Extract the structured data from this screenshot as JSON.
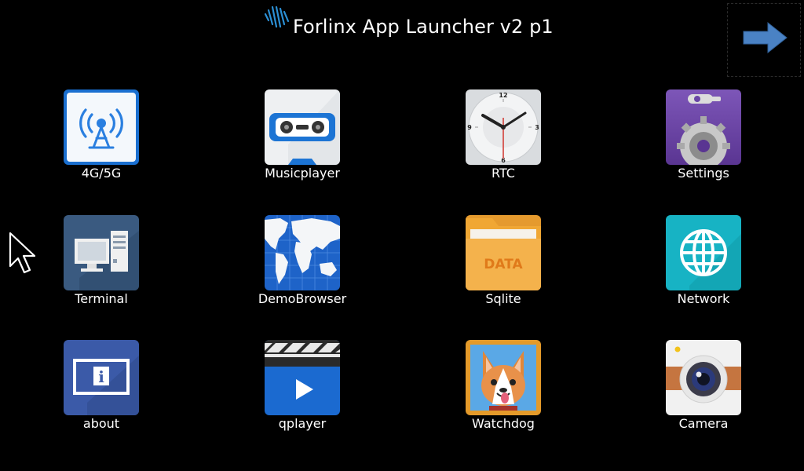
{
  "header": {
    "title": "Forlinx App Launcher v2 p1",
    "logo_icon": "forlinx-logo-icon",
    "next_icon": "arrow-right-icon"
  },
  "apps": [
    {
      "label": "4G/5G",
      "icon": "cellular-tower-icon"
    },
    {
      "label": "Musicplayer",
      "icon": "cassette-tape-icon"
    },
    {
      "label": "RTC",
      "icon": "clock-icon"
    },
    {
      "label": "Settings",
      "icon": "gear-wrench-icon"
    },
    {
      "label": "Terminal",
      "icon": "computer-terminal-icon"
    },
    {
      "label": "DemoBrowser",
      "icon": "world-map-icon"
    },
    {
      "label": "Sqlite",
      "icon": "data-folder-icon"
    },
    {
      "label": "Network",
      "icon": "globe-icon"
    },
    {
      "label": "about",
      "icon": "info-icon"
    },
    {
      "label": "qplayer",
      "icon": "video-play-icon"
    },
    {
      "label": "Watchdog",
      "icon": "corgi-dog-icon"
    },
    {
      "label": "Camera",
      "icon": "camera-icon"
    }
  ],
  "clock_numerals": [
    "12",
    "3",
    "6",
    "9"
  ],
  "sqlite_icon_text": "DATA",
  "about_icon_text": "i"
}
